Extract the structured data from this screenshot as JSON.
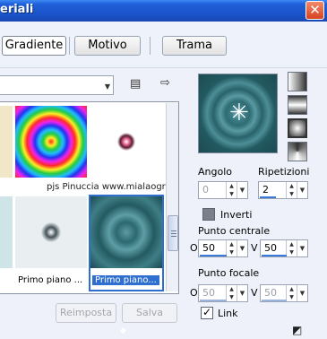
{
  "window": {
    "title": "eriali",
    "close": "✕"
  },
  "toolbar": {
    "tabs": [
      "Gradiente",
      "Motivo",
      "Trama"
    ],
    "active": "Gradiente"
  },
  "browser": {
    "combo_value": "",
    "thumbnails": [
      {
        "name": "",
        "palette": "gold"
      },
      {
        "name": "",
        "palette": "rainbow"
      },
      {
        "name": "",
        "palette": "pink"
      },
      {
        "name": "",
        "palette": "teal-light"
      },
      {
        "name": "Primo piano ...",
        "palette": "silver"
      },
      {
        "name": "Primo piano...",
        "palette": "teal",
        "selected": true
      }
    ],
    "watermark": "pjs  Pinuccia  www.mialaografica.eu",
    "buttons": {
      "reset": "Reimposta",
      "save": "Salva"
    }
  },
  "settings": {
    "angle_label": "Angolo",
    "angle_value": "0",
    "repeat_label": "Ripetizioni",
    "repeat_value": "2",
    "invert_label": "Inverti",
    "center_label": "Punto centrale",
    "center_h_label": "O",
    "center_h_value": "50",
    "center_v_label": "V",
    "center_v_value": "50",
    "focal_label": "Punto focale",
    "focal_h_label": "O",
    "focal_h_value": "50",
    "focal_v_label": "V",
    "focal_v_value": "50",
    "link_label": "Link"
  },
  "colors": {
    "accent": "#2f6fd0",
    "title_bar": "#1f5fd8",
    "preview_teal": "#2f6c74"
  }
}
